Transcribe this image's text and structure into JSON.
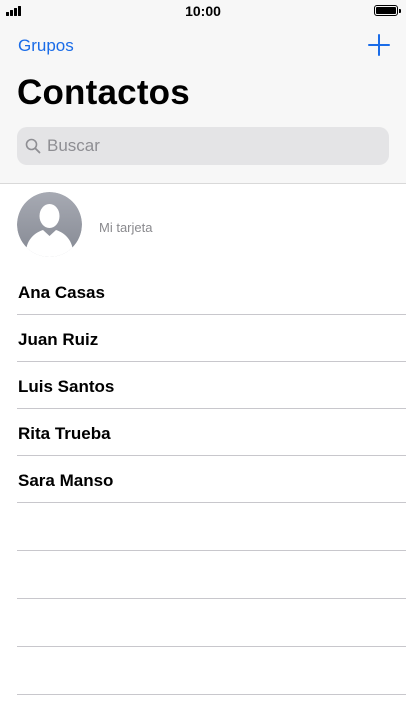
{
  "status_bar": {
    "time": "10:00"
  },
  "nav": {
    "groups_label": "Grupos"
  },
  "page": {
    "title": "Contactos"
  },
  "search": {
    "placeholder": "Buscar"
  },
  "my_card": {
    "label": "Mi tarjeta"
  },
  "contacts": [
    {
      "name": "Ana Casas"
    },
    {
      "name": "Juan Ruiz"
    },
    {
      "name": "Luis Santos"
    },
    {
      "name": "Rita Trueba"
    },
    {
      "name": "Sara Manso"
    }
  ],
  "colors": {
    "accent": "#1a6ce8",
    "secondary_text": "#8a8a8e",
    "separator": "#c8c7cc"
  },
  "icons": {
    "add": "plus-icon",
    "search": "magnifier-icon",
    "avatar": "person-silhouette-icon"
  }
}
